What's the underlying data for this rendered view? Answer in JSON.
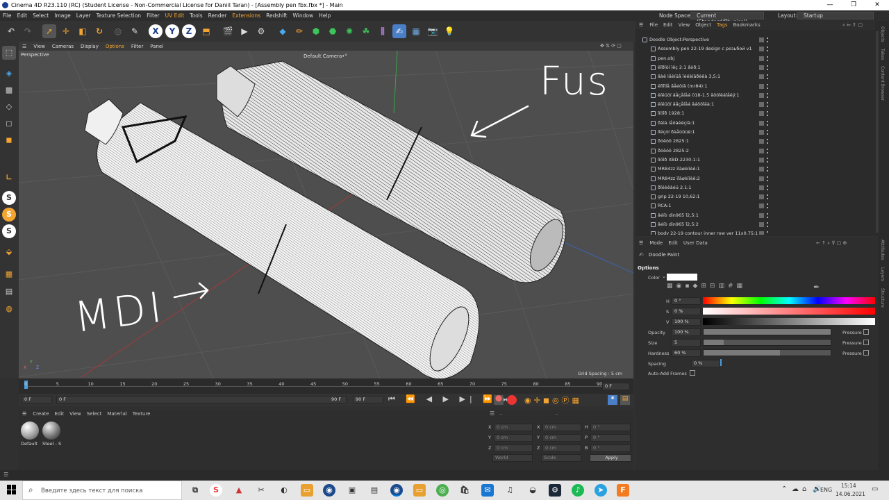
{
  "titlebar": {
    "title": "Cinema 4D R23.110 (RC) (Student License - Non-Commercial License for Daniil Taran) - [Assembly pen fbx.fbx *] - Main",
    "minimize": "—",
    "maximize": "❐",
    "close": "✕"
  },
  "menu": {
    "items": [
      "File",
      "Edit",
      "Select",
      "Image",
      "Layer",
      "Texture Selection",
      "Filter",
      "UV Edit",
      "Tools",
      "Render",
      "Extensions",
      "Redshift",
      "Window",
      "Help"
    ]
  },
  "nodespace": {
    "label": "Node Space:",
    "value": "Current (Standard/Physical)"
  },
  "layout": {
    "label": "Layout:",
    "value": "Startup"
  },
  "toolbar": {
    "x": "X",
    "y": "Y",
    "z": "Z"
  },
  "viewport": {
    "menu": [
      "View",
      "Cameras",
      "Display",
      "Options",
      "Filter",
      "Panel"
    ],
    "name": "Perspective",
    "camera": "Default Camera",
    "camera_mark": "•°",
    "grid": "Grid Spacing : 5 cm",
    "annotation_left": "MDI",
    "annotation_right": "Fus",
    "axis_x": "X",
    "axis_y": "Y",
    "axis_z": "Z"
  },
  "timeline": {
    "ticks": [
      "0",
      "5",
      "10",
      "15",
      "20",
      "25",
      "30",
      "35",
      "40",
      "45",
      "50",
      "55",
      "60",
      "65",
      "70",
      "75",
      "80",
      "85",
      "90"
    ],
    "current_frame": "0 F"
  },
  "playbar": {
    "start": "0 F",
    "start2": "0 F",
    "end": "90 F",
    "end2": "90 F"
  },
  "materials": {
    "menu": [
      "Create",
      "Edit",
      "View",
      "Select",
      "Material",
      "Texture"
    ],
    "items": [
      {
        "name": "Default"
      },
      {
        "name": "Steel - S"
      }
    ]
  },
  "coords": {
    "header": "--",
    "header2": "--",
    "rows": [
      {
        "a": "X",
        "av": "0 cm",
        "b": "X",
        "bv": "0 cm",
        "c": "H",
        "cv": "0 °"
      },
      {
        "a": "Y",
        "av": "0 cm",
        "b": "Y",
        "bv": "0 cm",
        "c": "P",
        "cv": "0 °"
      },
      {
        "a": "Z",
        "av": "0 cm",
        "b": "Z",
        "bv": "0 cm",
        "c": "B",
        "cv": "0 °"
      }
    ],
    "world": "World",
    "scale": "Scale",
    "apply": "Apply"
  },
  "objects": {
    "menu": [
      "File",
      "Edit",
      "View",
      "Object",
      "Tags",
      "Bookmarks"
    ],
    "rows": [
      "Doodle Object:Perspective",
      "Assembly pen 22-19 design  с резьбой v1",
      "pen.obj",
      "ëîðîòí ìëç 2:1 âòð:1",
      "âàë ìåèíüå ïèëèíäðèêà 3,5:1",
      "ëîïîîíå ãåéöíâ  (mr84):1",
      "ëíëüöí âåçåíåá 018-1.5 âôöîëáîåëÿ:1",
      "ëíëüöí âåçåíåá  âáôöîäà:1",
      "îíöîð 1928:1",
      "ðàìà íåôàèëçíà:1",
      "íîëçóí ðàåüûüë:1",
      "ðóêóô 2825:1",
      "ðóêóô 2825:2",
      "îíöîð XBD-2230-1:1",
      "MR84zz ïîäøèïíèê:1",
      "MR84zz ïîäøèïíèê:2",
      "ðîëèêàéü 2.1:1",
      "grip 22-19  10,62:1",
      "RCA:1",
      "âéíò din965  î2,5:1",
      "âéíò din965  î2,5:2",
      "body 22-19 contour inner row ver 11x0.75:1"
    ]
  },
  "attributes": {
    "menu": [
      "Mode",
      "Edit",
      "User Data"
    ],
    "title": "Doodle Paint",
    "section": "Options",
    "color_label": "Color",
    "h_label": "H",
    "h_value": "0 °",
    "s_label": "S",
    "s_value": "0 %",
    "v_label": "V",
    "v_value": "100 %",
    "opacity_label": "Opacity",
    "opacity_value": "100 %",
    "opacity_level": 1.0,
    "size_label": "Size",
    "size_value": "5",
    "size_level": 0.16,
    "hardness_label": "Hardness",
    "hardness_value": "60 %",
    "hardness_level": 0.6,
    "spacing_label": "Spacing",
    "spacing_value": "0 %",
    "pressure": "Pressure",
    "autoadd": "Auto-Add Frames"
  },
  "sidetabs": [
    "Objects",
    "Takes",
    "Content Browser",
    "Attributes",
    "Layers",
    "Structure"
  ],
  "taskbar": {
    "search": "Введите здесь текст для поиска",
    "lang": "ENG",
    "time": "15:14",
    "date": "14.06.2021"
  }
}
